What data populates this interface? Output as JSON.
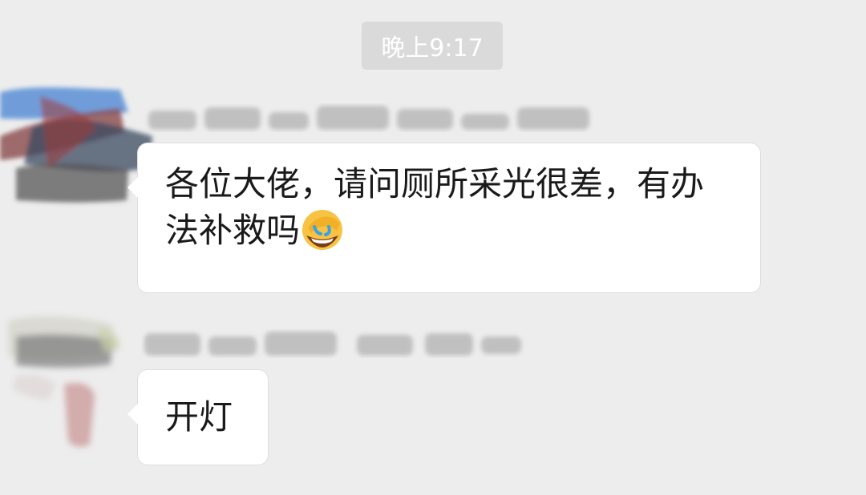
{
  "timestamp": "晚上9:17",
  "messages": [
    {
      "sender": "",
      "text": "各位大佬，请问厕所采光很差，有办法补救吗",
      "emoji": "face-palm-emoji"
    },
    {
      "sender": "",
      "text": "开灯"
    }
  ],
  "colors": {
    "background": "#ededed",
    "bubble": "#ffffff",
    "timestamp_bg": "#dadada",
    "text": "#1a1a1a"
  }
}
